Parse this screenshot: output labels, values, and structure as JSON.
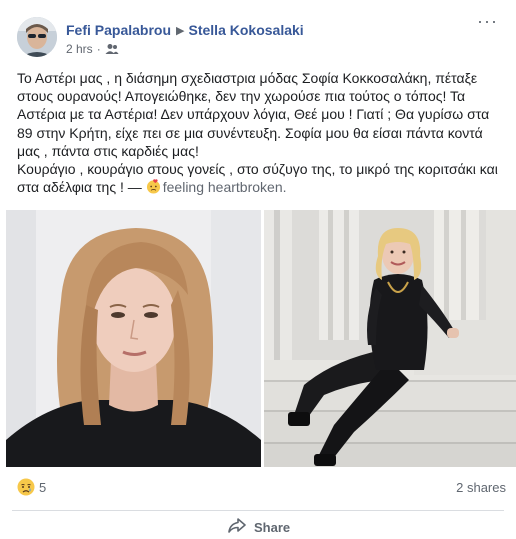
{
  "post": {
    "author": "Fefi Papalabrou",
    "target": "Stella Kokosalaki",
    "timestamp": "2 hrs",
    "privacy_icon": "friends-icon",
    "text": {
      "line1": "Το Αστέρι μας , η διάσημη σχεδιαστρια μόδας Σοφία Κοκκοσαλάκη, πέταξε στους ουρανούς! Απογειώθηκε, δεν την χωρούσε πια τούτος ο τόπος! Τα Αστέρια με τα Αστέρια! Δεν υπάρχουν λόγια, Θεέ μου ! Γιατί ; Θα γυρίσω στα 89 στην Κρήτη, είχε πει σε μια συνέντευξη. Σοφία μου θα είσαι πάντα κοντά μας , πάντα στις καρδιές μας!",
      "line2": "Κουράγιο , κουράγιο στους γονείς , στο σύζυγο της, το μικρό της κοριτσάκι και στα αδέλφια της ! —",
      "feeling": "feeling heartbroken."
    },
    "feeling_icon": "heartbroken-emoji-icon",
    "reactions": {
      "icon": "sad-reaction-icon",
      "count": "5"
    },
    "shares": "2 shares",
    "actions": {
      "share": "Share"
    },
    "colors": {
      "link": "#385898",
      "meta": "#616770",
      "divider": "#dadde1"
    }
  }
}
